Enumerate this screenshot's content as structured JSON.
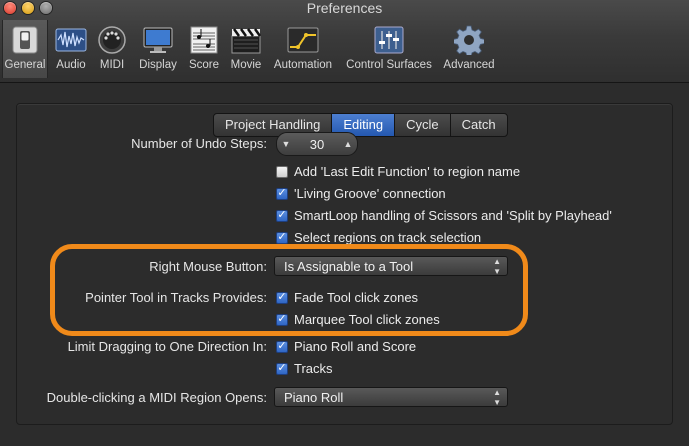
{
  "window": {
    "title": "Preferences"
  },
  "toolbar": {
    "items": [
      {
        "label": "General",
        "icon": "switch-icon"
      },
      {
        "label": "Audio",
        "icon": "waveform-icon"
      },
      {
        "label": "MIDI",
        "icon": "midi-connector-icon"
      },
      {
        "label": "Display",
        "icon": "monitor-icon"
      },
      {
        "label": "Score",
        "icon": "sheet-music-icon"
      },
      {
        "label": "Movie",
        "icon": "clapperboard-icon"
      },
      {
        "label": "Automation",
        "icon": "automation-icon"
      },
      {
        "label": "Control Surfaces",
        "icon": "faders-icon"
      },
      {
        "label": "Advanced",
        "icon": "gear-icon"
      }
    ]
  },
  "tabs": [
    {
      "label": "Project Handling",
      "active": false
    },
    {
      "label": "Editing",
      "active": true
    },
    {
      "label": "Cycle",
      "active": false
    },
    {
      "label": "Catch",
      "active": false
    }
  ],
  "editing": {
    "undo_label": "Number of Undo Steps:",
    "undo_value": "30",
    "checks": {
      "add_last_edit": {
        "label": "Add 'Last Edit Function' to region name",
        "checked": false
      },
      "living_groove": {
        "label": "'Living Groove' connection",
        "checked": true
      },
      "smartloop": {
        "label": "SmartLoop handling of Scissors and 'Split by Playhead'",
        "checked": true
      },
      "select_regions": {
        "label": "Select regions on track selection",
        "checked": true
      }
    },
    "right_mouse_label": "Right Mouse Button:",
    "right_mouse_value": "Is Assignable to a Tool",
    "pointer_tool_label": "Pointer Tool in Tracks Provides:",
    "fade_tool": {
      "label": "Fade Tool click zones",
      "checked": true
    },
    "marquee_tool": {
      "label": "Marquee Tool click zones",
      "checked": true
    },
    "limit_drag_label": "Limit Dragging to One Direction In:",
    "piano_roll_score": {
      "label": "Piano Roll and Score",
      "checked": true
    },
    "tracks": {
      "label": "Tracks",
      "checked": true
    },
    "double_click_label": "Double-clicking a MIDI Region Opens:",
    "double_click_value": "Piano Roll"
  },
  "colors": {
    "highlight": "#f08a1a",
    "accent": "#2f66c4",
    "background": "#2c2c2c"
  }
}
